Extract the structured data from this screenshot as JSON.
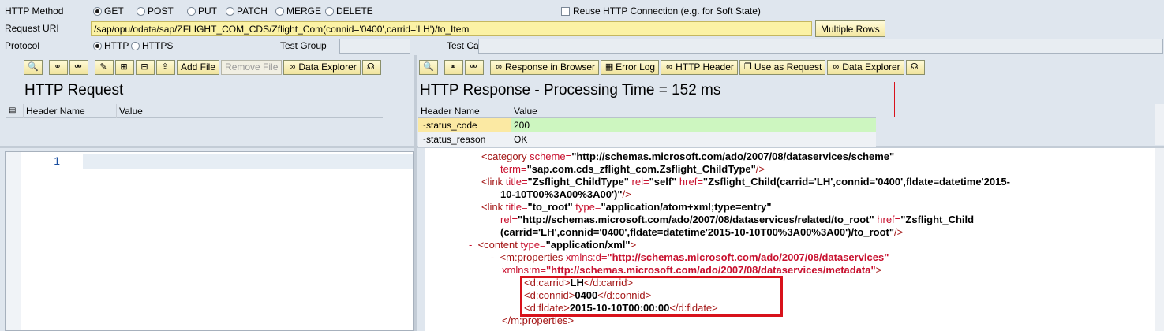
{
  "form": {
    "method_label": "HTTP Method",
    "methods": [
      {
        "label": "GET",
        "selected": true
      },
      {
        "label": "POST",
        "selected": false
      },
      {
        "label": "PUT",
        "selected": false
      },
      {
        "label": "PATCH",
        "selected": false
      },
      {
        "label": "MERGE",
        "selected": false
      },
      {
        "label": "DELETE",
        "selected": false
      }
    ],
    "reuse_label": "Reuse HTTP Connection (e.g. for Soft State)",
    "uri_label": "Request URI",
    "uri_value": "/sap/opu/odata/sap/ZFLIGHT_COM_CDS/Zflight_Com(connid='0400',carrid='LH')/to_Item",
    "multiple_rows_label": "Multiple Rows",
    "protocol_label": "Protocol",
    "protocols": [
      {
        "label": "HTTP",
        "selected": true
      },
      {
        "label": "HTTPS",
        "selected": false
      }
    ],
    "test_group_label": "Test Group",
    "test_group_value": "",
    "test_case_label": "Test Case",
    "test_case_value": ""
  },
  "request": {
    "toolbar": {
      "add_file": "Add File",
      "remove_file": "Remove File",
      "data_explorer": "Data Explorer"
    },
    "title": "HTTP Request",
    "columns": [
      "Header Name",
      "Value"
    ],
    "editor_line": "1"
  },
  "response": {
    "toolbar": {
      "response_in_browser": "Response in Browser",
      "error_log": "Error Log",
      "http_header": "HTTP Header",
      "use_as_request": "Use as Request",
      "data_explorer": "Data Explorer"
    },
    "title": "HTTP Response - Processing Time = 152  ms",
    "columns": [
      "Header Name",
      "Value"
    ],
    "headers": [
      {
        "name": "~status_code",
        "value": "200"
      },
      {
        "name": "~status_reason",
        "value": "OK"
      }
    ]
  },
  "xml": {
    "l1_tag": "<category",
    "l1_attr1": " scheme=",
    "l1_val1": "\"http://schemas.microsoft.com/ado/2007/08/dataservices/scheme\"",
    "l2_attr": "term=",
    "l2_val": "\"sap.com.cds_zflight_com.Zsflight_ChildType\"",
    "l2_end": "/>",
    "l3_tag": "<link",
    "l3_attr1": " title=",
    "l3_val1": "\"Zsflight_ChildType\"",
    "l3_attr2": " rel=",
    "l3_val2": "\"self\"",
    "l3_attr3": " href=",
    "l3_val3": "\"Zsflight_Child(carrid='LH',connid='0400',fldate=datetime'2015-",
    "l4_val": "10-10T00%3A00%3A00')\"",
    "l4_end": "/>",
    "l5_tag": "<link",
    "l5_attr1": " title=",
    "l5_val1": "\"to_root\"",
    "l5_attr2": " type=",
    "l5_val2": "\"application/atom+xml;type=entry\"",
    "l6_attr1": "rel=",
    "l6_val1": "\"http://schemas.microsoft.com/ado/2007/08/dataservices/related/to_root\"",
    "l6_attr2": " href=",
    "l6_val2": "\"Zsflight_Child",
    "l7_val": "(carrid='LH',connid='0400',fldate=datetime'2015-10-10T00%3A00%3A00')/to_root\"",
    "l7_end": "/>",
    "l8_minus": "-",
    "l8_tag": "<content",
    "l8_attr": " type=",
    "l8_val": "\"application/xml\"",
    "l8_end": ">",
    "l9_minus": "-",
    "l9_tag": "<m:properties",
    "l9_attr": " xmlns:d=",
    "l9_val": "\"http://schemas.microsoft.com/ado/2007/08/dataservices\"",
    "l10_attr": "xmlns:m=",
    "l10_val": "\"http://schemas.microsoft.com/ado/2007/08/dataservices/metadata\"",
    "l10_end": ">",
    "l11_open": "<d:carrid>",
    "l11_val": "LH",
    "l11_close": "</d:carrid>",
    "l12_open": "<d:connid>",
    "l12_val": "0400",
    "l12_close": "</d:connid>",
    "l13_open": "<d:fldate>",
    "l13_val": "2015-10-10T00:00:00",
    "l13_close": "</d:fldate>",
    "l14_close": "</m:properties>"
  },
  "colors": {
    "highlight_box": "#d8121b",
    "status_code_bg": "#fbe9a3",
    "status_value_bg": "#cdf6c0"
  }
}
